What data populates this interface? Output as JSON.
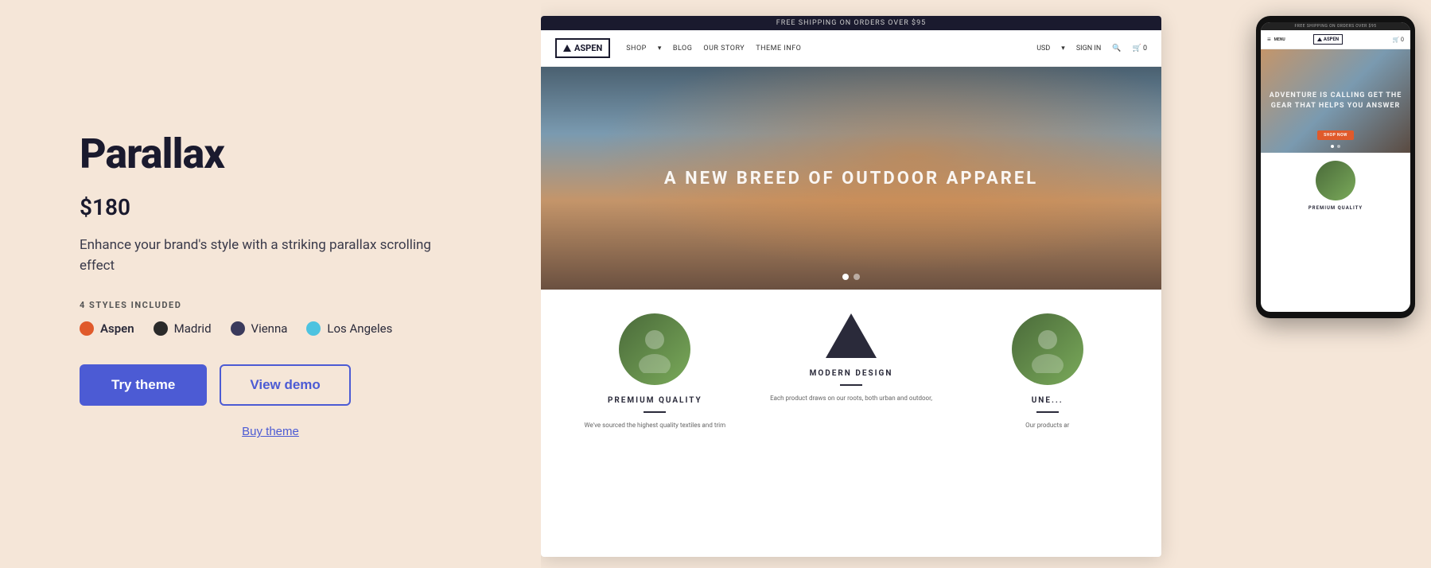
{
  "left": {
    "title": "Parallax",
    "price": "$180",
    "description": "Enhance your brand's style with a striking parallax scrolling effect",
    "styles_label": "4 STYLES INCLUDED",
    "styles": [
      {
        "name": "Aspen",
        "key": "aspen",
        "active": true
      },
      {
        "name": "Madrid",
        "key": "madrid",
        "active": false
      },
      {
        "name": "Vienna",
        "key": "vienna",
        "active": false
      },
      {
        "name": "Los Angeles",
        "key": "losangeles",
        "active": false
      }
    ],
    "try_button": "Try theme",
    "demo_button": "View demo",
    "buy_link": "Buy theme"
  },
  "preview": {
    "top_bar": "FREE SHIPPING ON ORDERS OVER $95",
    "logo": "ASPEN",
    "nav_links": [
      "SHOP",
      "BLOG",
      "OUR STORY",
      "THEME INFO"
    ],
    "nav_right": [
      "USD",
      "SIGN IN"
    ],
    "hero_text": "A NEW BREED OF OUTDOOR APPAREL",
    "features": [
      {
        "title": "PREMIUM QUALITY",
        "text": "We've sourced the highest quality textiles and trim"
      },
      {
        "title": "MODERN DESIGN",
        "text": "Each product draws on our roots, both urban and outdoor,"
      },
      {
        "title": "UNE...",
        "text": "Our products ar"
      }
    ]
  },
  "mobile": {
    "top_bar": "FREE SHIPPING ON ORDERS OVER $95",
    "logo": "ASPEN",
    "menu_label": "MENU",
    "hero_text": "ADVENTURE IS CALLING GET THE GEAR THAT HELPS YOU ANSWER",
    "shop_now": "SHOP NOW",
    "feature_title": "PREMIUM QUALITY"
  }
}
